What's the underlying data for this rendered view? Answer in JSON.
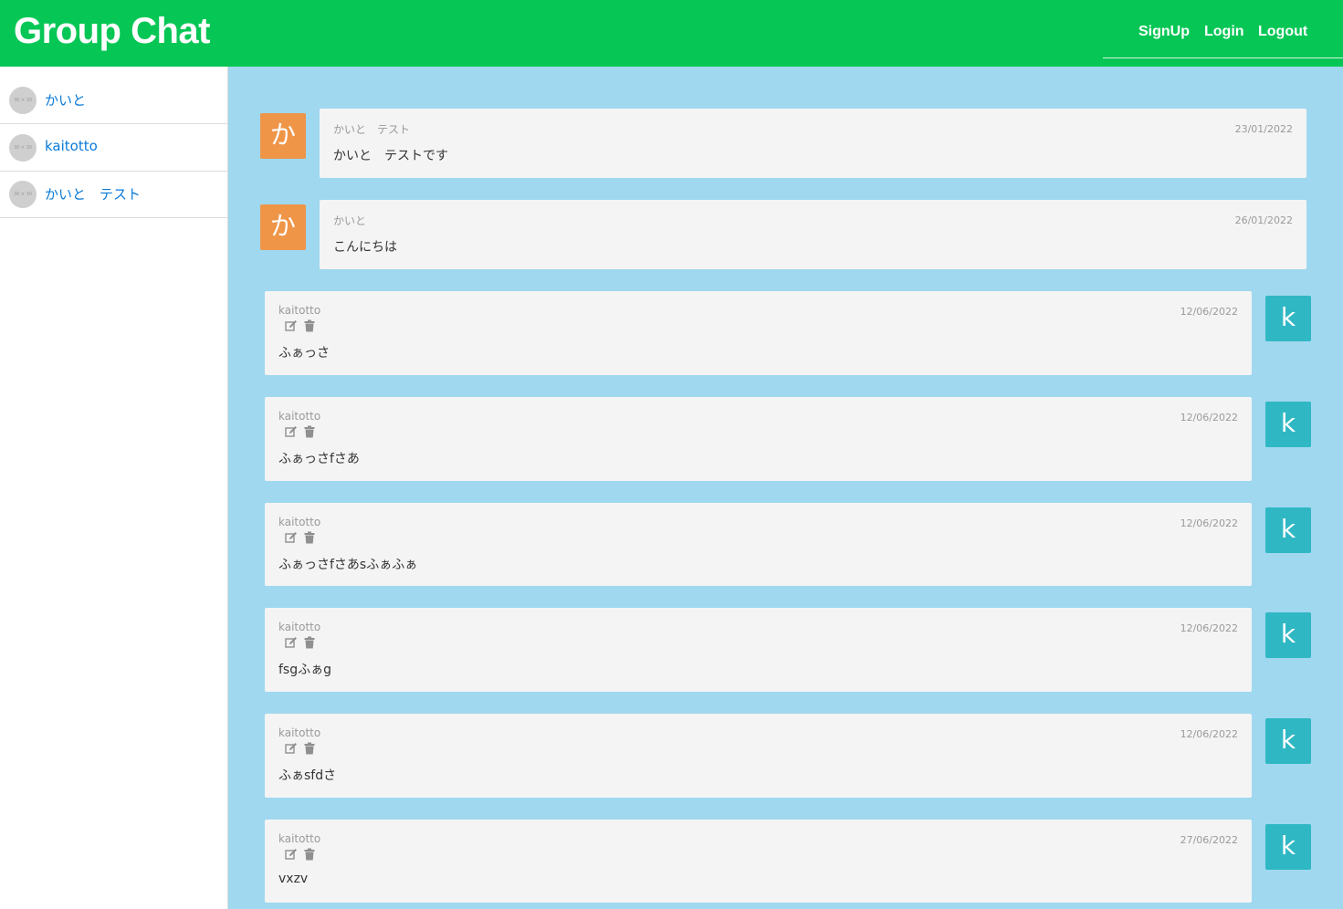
{
  "header": {
    "title": "Group Chat",
    "nav": {
      "signup": "SignUp",
      "login": "Login",
      "logout": "Logout"
    }
  },
  "sidebar": {
    "users": [
      {
        "name": "かいと",
        "thumb": "30 × 30"
      },
      {
        "name": "kaitotto",
        "thumb": "30 × 30"
      },
      {
        "name": "かいと　テスト",
        "thumb": "30 × 30"
      }
    ]
  },
  "messages": [
    {
      "author": "かいと　テスト",
      "initial": "か",
      "date": "23/01/2022",
      "text": "かいと　テストです",
      "own": false
    },
    {
      "author": "かいと",
      "initial": "か",
      "date": "26/01/2022",
      "text": "こんにちは",
      "own": false
    },
    {
      "author": "kaitotto",
      "initial": "k",
      "date": "12/06/2022",
      "text": "ふぁっさ",
      "own": true
    },
    {
      "author": "kaitotto",
      "initial": "k",
      "date": "12/06/2022",
      "text": "ふぁっさfさあ",
      "own": true
    },
    {
      "author": "kaitotto",
      "initial": "k",
      "date": "12/06/2022",
      "text": "ふぁっさfさあsふぁふぁ",
      "own": true
    },
    {
      "author": "kaitotto",
      "initial": "k",
      "date": "12/06/2022",
      "text": "fsgふぁg",
      "own": true
    },
    {
      "author": "kaitotto",
      "initial": "k",
      "date": "12/06/2022",
      "text": "ふぁsfdさ",
      "own": true
    },
    {
      "author": "kaitotto",
      "initial": "k",
      "date": "27/06/2022",
      "text": "vxzv",
      "own": true
    }
  ],
  "colors": {
    "header": "#06c755",
    "chat_background": "#a0d8ef",
    "other_avatar": "#ef9548",
    "own_avatar": "#2fb8c4",
    "link": "#0a7ad8"
  },
  "icons": {
    "edit": "edit-icon",
    "delete": "trash-icon"
  }
}
